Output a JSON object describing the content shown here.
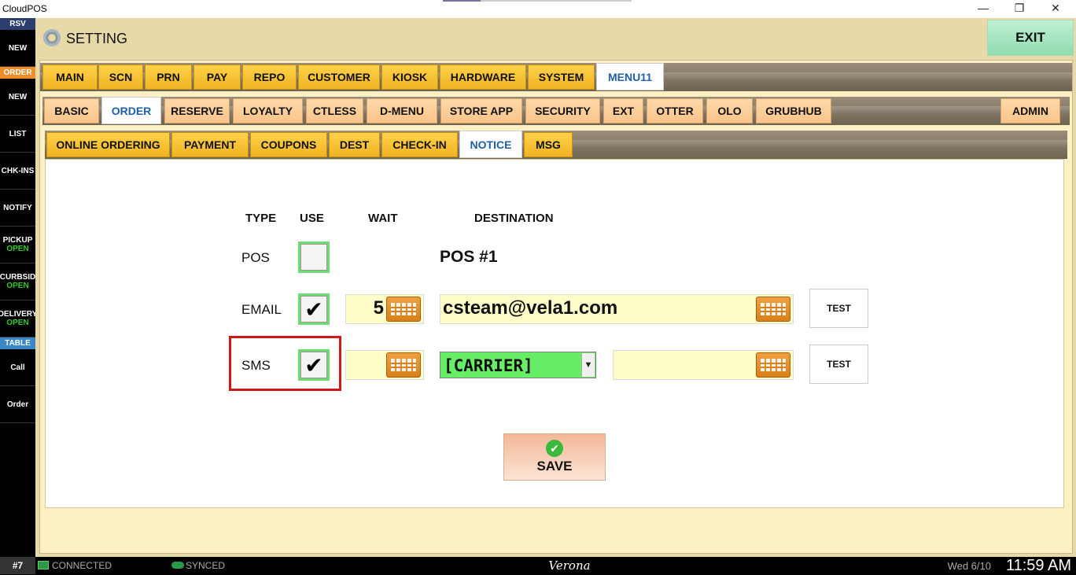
{
  "window": {
    "title": "CloudPOS",
    "minimize": "—",
    "restore": "❐",
    "close": "✕"
  },
  "sidebar": {
    "rsv_label": "RSV",
    "rsv_items": [
      {
        "label": "NEW"
      }
    ],
    "order_label": "ORDER",
    "order_items": [
      {
        "label": "NEW",
        "sub": ""
      },
      {
        "label": "LIST",
        "sub": ""
      },
      {
        "label": "CHK-INS",
        "sub": ""
      },
      {
        "label": "NOTIFY",
        "sub": ""
      },
      {
        "label": "PICKUP",
        "sub": "OPEN"
      },
      {
        "label": "CURBSID",
        "sub": "OPEN"
      },
      {
        "label": "DELIVERY",
        "sub": "OPEN"
      }
    ],
    "table_label": "TABLE",
    "table_items": [
      {
        "label": "Call"
      },
      {
        "label": "Order"
      }
    ]
  },
  "header": {
    "title": "SETTING",
    "exit_label": "EXIT"
  },
  "tabs_level1": [
    "MAIN",
    "SCN",
    "PRN",
    "PAY",
    "REPO",
    "CUSTOMER",
    "KIOSK",
    "HARDWARE",
    "SYSTEM",
    "MENU11"
  ],
  "tabs_level1_active": "MENU11",
  "tabs_level2": [
    "BASIC",
    "ORDER",
    "RESERVE",
    "LOYALTY",
    "CTLESS",
    "D-MENU",
    "STORE APP",
    "SECURITY",
    "EXT",
    "OTTER",
    "OLO",
    "GRUBHUB"
  ],
  "tabs_level2_active": "ORDER",
  "tabs_level2_right": "ADMIN",
  "tabs_level3": [
    "ONLINE ORDERING",
    "PAYMENT",
    "COUPONS",
    "DEST",
    "CHECK-IN",
    "NOTICE",
    "MSG"
  ],
  "tabs_level3_active": "NOTICE",
  "notice": {
    "columns": {
      "type": "TYPE",
      "use": "USE",
      "wait": "WAIT",
      "destination": "DESTINATION"
    },
    "rows": {
      "pos": {
        "type": "POS",
        "use": false,
        "destination": "POS #1"
      },
      "email": {
        "type": "EMAIL",
        "use": true,
        "wait": "5",
        "destination": "csteam@vela1.com",
        "test_label": "TEST"
      },
      "sms": {
        "type": "SMS",
        "use": true,
        "wait": "",
        "carrier": "[CARRIER]",
        "destination": "",
        "test_label": "TEST"
      }
    },
    "check_mark": "✔",
    "save_label": "SAVE",
    "save_icon": "✔"
  },
  "status": {
    "station": "#7",
    "connection": "CONNECTED",
    "sync": "SYNCED",
    "store": "Verona",
    "date": "Wed 6/10",
    "time": "11:59 AM"
  },
  "colors": {
    "tab_yellow": "#ffd24a",
    "tab_active_text": "#1f5fa8",
    "checkbox_green": "#6edc6e",
    "select_green": "#66ee66",
    "highlight_red": "#d01818",
    "panel_bg": "#fdf0c4"
  },
  "icons": {
    "gear": "gear-icon",
    "keyboard": "keyboard-icon",
    "save_check": "check-circle-icon",
    "connected": "computer-icon",
    "synced": "cloud-icon"
  }
}
